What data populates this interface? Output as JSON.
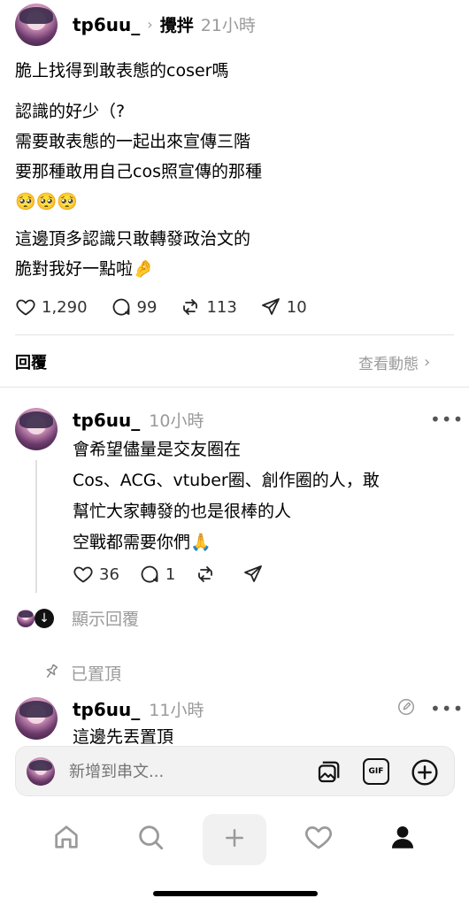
{
  "post": {
    "username": "tp6uu_",
    "tag": "攪拌",
    "time": "21小時",
    "lines": [
      "脆上找得到敢表態的coser嗎",
      "認識的好少（?",
      "需要敢表態的一起出來宣傳三階",
      "要那種敢用自己cos照宣傳的那種",
      "🥺🥺🥺",
      "這邊頂多認識只敢轉發政治文的",
      "脆對我好一點啦🤌"
    ],
    "likes": "1,290",
    "comments": "99",
    "reposts": "113",
    "shares": "10"
  },
  "reply_header": {
    "title": "回覆",
    "activity_link": "查看動態"
  },
  "reply1": {
    "username": "tp6uu_",
    "time": "10小時",
    "lines": [
      "會希望儘量是交友圈在",
      "Cos、ACG、vtuber圈、創作圈的人，敢",
      "幫忙大家轉發的也是很棒的人",
      "空戰都需要你們🙏"
    ],
    "likes": "36",
    "comments": "1",
    "show_replies": "顯示回覆"
  },
  "pinned": {
    "label": "已置頂",
    "username": "tp6uu_",
    "time": "11小時",
    "text": "這邊先丟置頂"
  },
  "composer": {
    "placeholder": "新增到串文..."
  },
  "colors": {
    "muted": "#9a9a9a",
    "divider": "#e3e3e3",
    "composer_bg": "#f2f2f2"
  }
}
